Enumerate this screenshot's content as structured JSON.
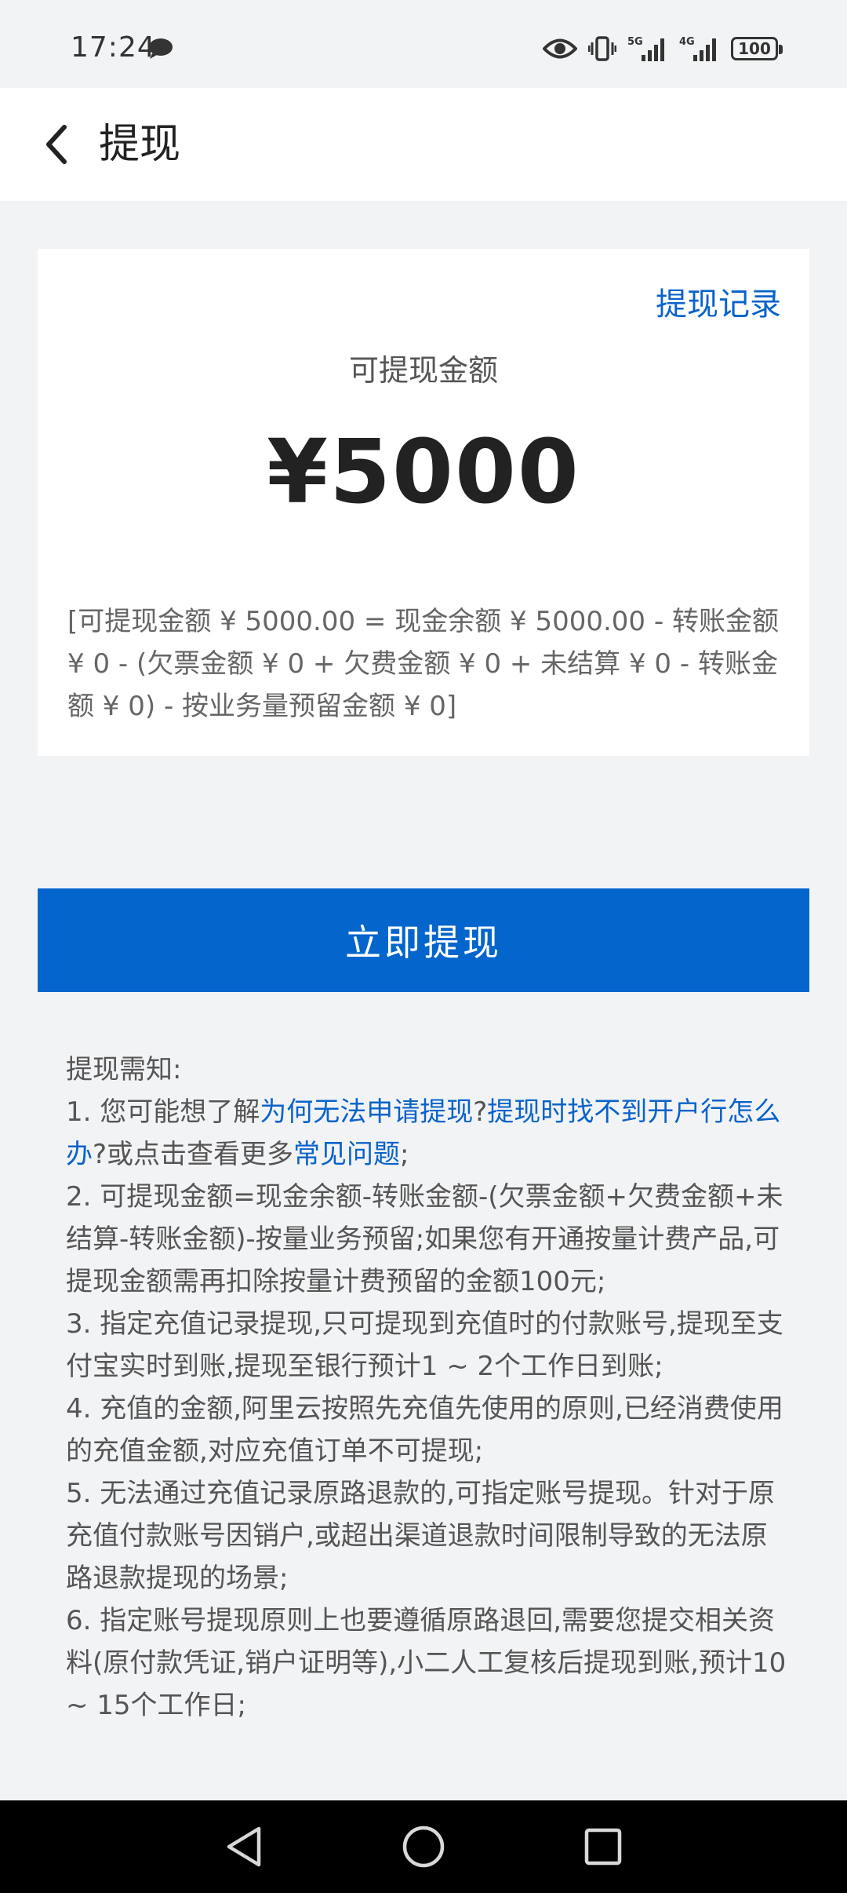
{
  "status_bar": {
    "time": "17:24",
    "network_1": "5G",
    "network_2": "4G",
    "battery": "100"
  },
  "header": {
    "title": "提现"
  },
  "balance": {
    "record_link": "提现记录",
    "label": "可提现金额",
    "amount": "¥5000",
    "formula": "[可提现金额 ¥ 5000.00 = 现金余额 ¥ 5000.00 - 转账金额 ¥ 0 - (欠票金额 ¥ 0 + 欠费金额 ¥ 0 + 未结算 ¥ 0 - 转账金额 ¥ 0) - 按业务量预留金额 ¥ 0]"
  },
  "withdraw_button": "立即提现",
  "notice": {
    "title": "提现需知:",
    "item1_prefix": "1. 您可能想了解",
    "item1_link1": "为何无法申请提现",
    "item1_sep": "?",
    "item1_link2": "提现时找不到开户行怎么办",
    "item1_mid": "?或点击查看更多",
    "item1_link3": "常见问题",
    "item1_end": ";",
    "item2": "2. 可提现金额=现金余额-转账金额-(欠票金额+欠费金额+未结算-转账金额)-按量业务预留;如果您有开通按量计费产品,可提现金额需再扣除按量计费预留的金额100元;",
    "item3": "3. 指定充值记录提现,只可提现到充值时的付款账号,提现至支付宝实时到账,提现至银行预计1 ~ 2个工作日到账;",
    "item4": "4. 充值的金额,阿里云按照先充值先使用的原则,已经消费使用的充值金额,对应充值订单不可提现;",
    "item5": "5. 无法通过充值记录原路退款的,可指定账号提现。针对于原充值付款账号因销户,或超出渠道退款时间限制导致的无法原路退款提现的场景;",
    "item6": "6. 指定账号提现原则上也要遵循原路退回,需要您提交相关资料(原付款凭证,销户证明等),小二人工复核后提现到账,预计10 ~ 15个工作日;"
  },
  "colors": {
    "accent": "#0465cc",
    "link": "#0a63c9",
    "background": "#f2f3f5"
  }
}
